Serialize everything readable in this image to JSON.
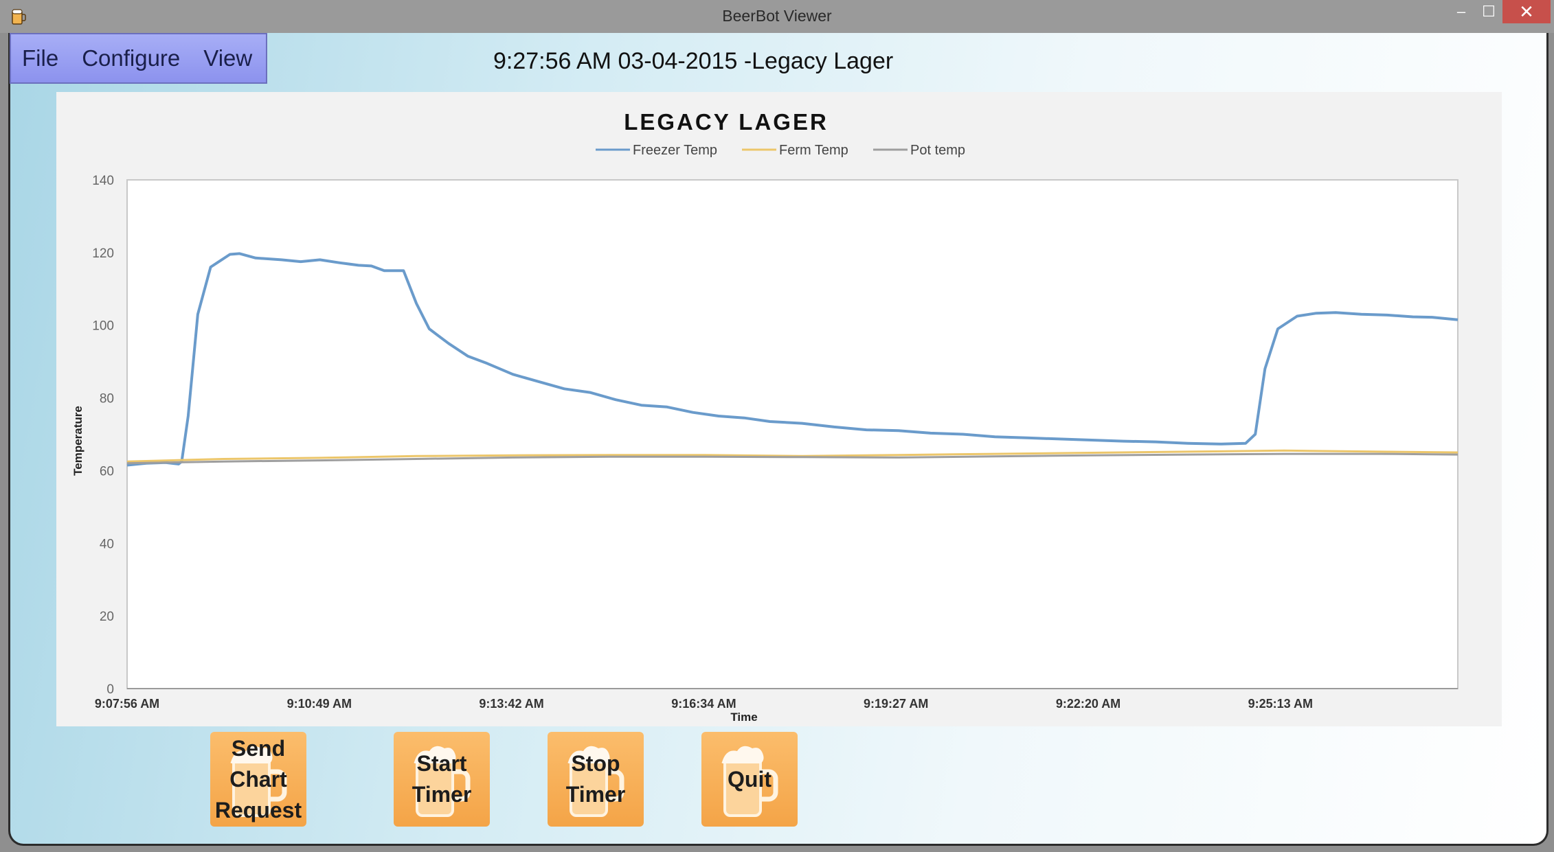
{
  "window": {
    "title": "BeerBot Viewer",
    "minimize_glyph": "–",
    "maximize_glyph": "☐",
    "close_glyph": "✕"
  },
  "menu": {
    "items": [
      "File",
      "Configure",
      "View"
    ]
  },
  "header": {
    "status": "9:27:56 AM 03-04-2015 -Legacy Lager"
  },
  "colors": {
    "freezer": "#6a9bcb",
    "ferm": "#ecc66a",
    "pot": "#9e9e9e",
    "button": "#f5a64a"
  },
  "chart_data": {
    "type": "line",
    "title": "LEGACY LAGER",
    "xlabel": "Time",
    "ylabel": "Temperature",
    "ylim": [
      0,
      140
    ],
    "yticks": [
      "0",
      "20",
      "40",
      "60",
      "80",
      "100",
      "120",
      "140"
    ],
    "xticks": [
      "9:07:56 AM",
      "9:10:49 AM",
      "9:13:42 AM",
      "9:16:34 AM",
      "9:19:27 AM",
      "9:22:20 AM",
      "9:25:13 AM"
    ],
    "xlim_minutes": [
      0,
      20.7
    ],
    "legend_position": "top-center",
    "grid": false,
    "series": [
      {
        "name": "Freezer Temp",
        "points": [
          [
            0,
            61.5
          ],
          [
            0.3,
            62
          ],
          [
            0.6,
            62.2
          ],
          [
            0.8,
            61.8
          ],
          [
            0.85,
            62.5
          ],
          [
            0.95,
            75
          ],
          [
            1.1,
            103
          ],
          [
            1.3,
            116
          ],
          [
            1.6,
            119.5
          ],
          [
            1.75,
            119.7
          ],
          [
            2.0,
            118.5
          ],
          [
            2.4,
            118
          ],
          [
            2.7,
            117.5
          ],
          [
            3.0,
            118
          ],
          [
            3.3,
            117.2
          ],
          [
            3.6,
            116.5
          ],
          [
            3.8,
            116.3
          ],
          [
            4.0,
            115
          ],
          [
            4.3,
            115
          ],
          [
            4.5,
            106
          ],
          [
            4.7,
            99
          ],
          [
            5.0,
            95
          ],
          [
            5.3,
            91.5
          ],
          [
            5.6,
            89.5
          ],
          [
            6.0,
            86.5
          ],
          [
            6.4,
            84.5
          ],
          [
            6.8,
            82.5
          ],
          [
            7.2,
            81.5
          ],
          [
            7.6,
            79.5
          ],
          [
            8.0,
            78
          ],
          [
            8.4,
            77.5
          ],
          [
            8.8,
            76
          ],
          [
            9.2,
            75
          ],
          [
            9.6,
            74.5
          ],
          [
            10.0,
            73.5
          ],
          [
            10.5,
            73
          ],
          [
            11.0,
            72
          ],
          [
            11.5,
            71.2
          ],
          [
            12.0,
            71
          ],
          [
            12.5,
            70.3
          ],
          [
            13.0,
            70
          ],
          [
            13.5,
            69.3
          ],
          [
            14.0,
            69
          ],
          [
            14.5,
            68.7
          ],
          [
            15.0,
            68.4
          ],
          [
            15.5,
            68.1
          ],
          [
            16.0,
            67.9
          ],
          [
            16.5,
            67.5
          ],
          [
            17.0,
            67.3
          ],
          [
            17.4,
            67.5
          ],
          [
            17.55,
            70
          ],
          [
            17.7,
            88
          ],
          [
            17.9,
            99
          ],
          [
            18.2,
            102.5
          ],
          [
            18.5,
            103.3
          ],
          [
            18.8,
            103.5
          ],
          [
            19.2,
            103
          ],
          [
            19.6,
            102.8
          ],
          [
            20.0,
            102.3
          ],
          [
            20.3,
            102.2
          ],
          [
            20.7,
            101.5
          ]
        ]
      },
      {
        "name": "Ferm Temp",
        "points": [
          [
            0,
            62.5
          ],
          [
            1.5,
            63.2
          ],
          [
            3,
            63.5
          ],
          [
            4.5,
            64
          ],
          [
            6,
            64.2
          ],
          [
            7.5,
            64.3
          ],
          [
            9,
            64.3
          ],
          [
            10.5,
            64
          ],
          [
            12,
            64.3
          ],
          [
            13.5,
            64.6
          ],
          [
            15,
            64.9
          ],
          [
            16.5,
            65.2
          ],
          [
            18,
            65.5
          ],
          [
            19.5,
            65.2
          ],
          [
            20.7,
            65
          ]
        ]
      },
      {
        "name": "Pot temp",
        "points": [
          [
            0,
            62
          ],
          [
            1.5,
            62.5
          ],
          [
            3,
            62.8
          ],
          [
            4.5,
            63.2
          ],
          [
            6,
            63.6
          ],
          [
            7.5,
            63.8
          ],
          [
            9,
            63.8
          ],
          [
            10.5,
            63.7
          ],
          [
            12,
            63.6
          ],
          [
            13.5,
            63.9
          ],
          [
            15,
            64.2
          ],
          [
            16.5,
            64.4
          ],
          [
            18,
            64.6
          ],
          [
            19.5,
            64.6
          ],
          [
            20.7,
            64.4
          ]
        ]
      }
    ]
  },
  "buttons": [
    {
      "label": "Send\nChart\nRequest"
    },
    {
      "label": "Start\nTimer"
    },
    {
      "label": "Stop\nTimer"
    },
    {
      "label": "Quit"
    }
  ]
}
